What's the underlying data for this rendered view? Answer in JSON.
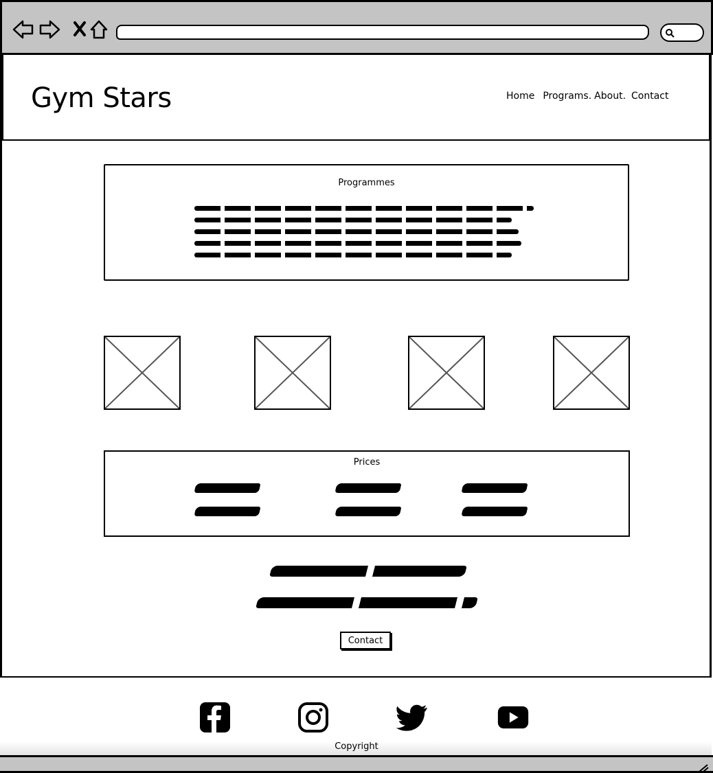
{
  "site": {
    "brand": "Gym Stars",
    "nav": [
      "Home",
      "Programs.",
      "About.",
      "Contact"
    ]
  },
  "programmes": {
    "title": "Programmes"
  },
  "prices": {
    "title": "Prices"
  },
  "cta": {
    "button_label": "Contact"
  },
  "footer": {
    "social_icons": [
      "facebook-icon",
      "instagram-icon",
      "twitter-icon",
      "youtube-icon"
    ],
    "copyright": "Copyright"
  }
}
